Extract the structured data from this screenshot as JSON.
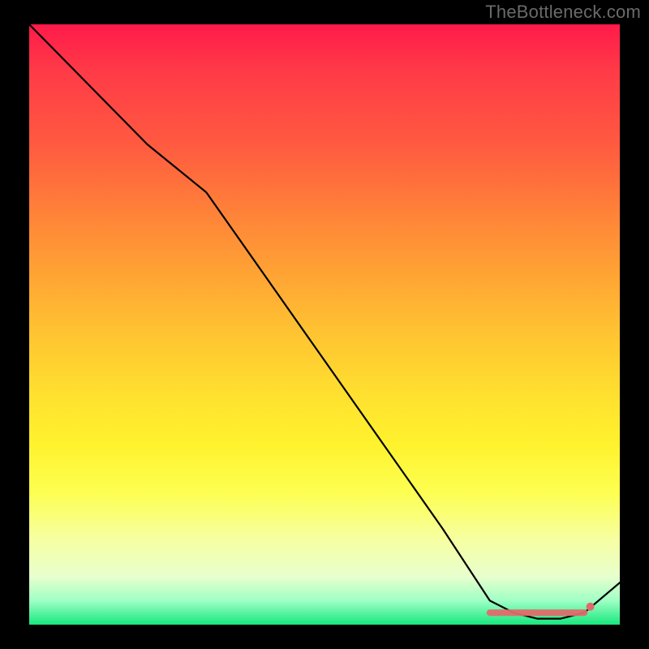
{
  "branding": {
    "watermark": "TheBottleneck.com"
  },
  "colors": {
    "gradient_top": "#ff1a4a",
    "gradient_mid_orange": "#ffa534",
    "gradient_yellow": "#fff22e",
    "gradient_bottom_green": "#17e87e",
    "curve": "#000000",
    "highlight": "#e06a6a",
    "frame": "#000000"
  },
  "chart_data": {
    "type": "line",
    "title": "",
    "xlabel": "",
    "ylabel": "",
    "xlim": [
      0,
      100
    ],
    "ylim": [
      0,
      100
    ],
    "grid": false,
    "legend": false,
    "series": [
      {
        "name": "bottleneck-curve",
        "x": [
          0,
          10,
          20,
          30,
          40,
          50,
          60,
          70,
          78,
          82,
          86,
          90,
          94,
          100
        ],
        "y": [
          100,
          90,
          80,
          72,
          58,
          44,
          30,
          16,
          4,
          2,
          1,
          1,
          2,
          7
        ]
      }
    ],
    "highlight_range": {
      "x_start": 78,
      "x_end": 94,
      "y": 2,
      "marker_x": 95,
      "marker_y": 3
    }
  }
}
